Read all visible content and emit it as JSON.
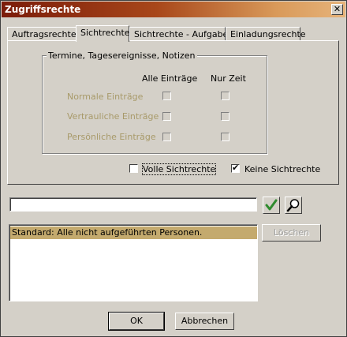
{
  "window": {
    "title": "Zugriffsrechte"
  },
  "tabs": [
    "Auftragsrechte",
    "Sichtrechte",
    "Sichtrechte - Aufgaben",
    "Einladungsrechte"
  ],
  "group": {
    "label": "Termine, Tagesereignisse, Notizen",
    "col_all": "Alle Einträge",
    "col_time": "Nur Zeit",
    "rows": [
      "Normale Einträge",
      "Vertrauliche Einträge",
      "Persönliche Einträge"
    ]
  },
  "options": {
    "full_rights_label": "Volle Sichtrechte",
    "full_rights_checked": false,
    "no_rights_label": "Keine Sichtrechte",
    "no_rights_checked": true,
    "check_glyph": "✔"
  },
  "search": {
    "value": "",
    "placeholder": ""
  },
  "list": {
    "items": [
      "Standard: Alle nicht aufgeführten Personen."
    ]
  },
  "buttons": {
    "delete": "Löschen",
    "ok": "OK",
    "cancel": "Abbrechen",
    "close": "✕"
  },
  "colors": {
    "accent_green": "#2e8b2e",
    "disabled_text": "#a89a6a",
    "selection": "#c4aa6e"
  }
}
